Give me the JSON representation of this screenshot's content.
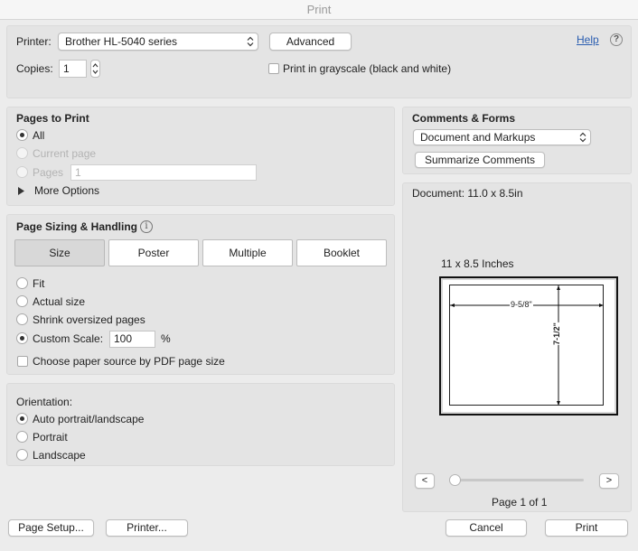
{
  "window": {
    "title": "Print"
  },
  "printer": {
    "label": "Printer:",
    "selected": "Brother HL-5040 series",
    "advanced_label": "Advanced",
    "help_label": "Help",
    "help_icon": "?",
    "copies_label": "Copies:",
    "copies_value": "1",
    "grayscale_label": "Print in grayscale (black and white)",
    "grayscale_checked": false
  },
  "pages_to_print": {
    "title": "Pages to Print",
    "all_label": "All",
    "current_label": "Current page",
    "pages_label": "Pages",
    "pages_placeholder": "1",
    "more_options_label": "More Options",
    "selected": "all"
  },
  "sizing": {
    "title": "Page Sizing & Handling",
    "info_icon": "i",
    "tabs": [
      "Size",
      "Poster",
      "Multiple",
      "Booklet"
    ],
    "active_tab": "Size",
    "fit_label": "Fit",
    "actual_label": "Actual size",
    "shrink_label": "Shrink oversized pages",
    "custom_label": "Custom Scale:",
    "custom_value": "100",
    "percent": "%",
    "paper_source_label": "Choose paper source by PDF page size",
    "selected": "custom"
  },
  "orientation": {
    "title": "Orientation:",
    "auto_label": "Auto portrait/landscape",
    "portrait_label": "Portrait",
    "landscape_label": "Landscape",
    "selected": "auto"
  },
  "comments": {
    "title": "Comments & Forms",
    "selected": "Document and Markups",
    "summarize_label": "Summarize Comments"
  },
  "preview": {
    "document_label": "Document: 11.0 x 8.5in",
    "size_label": "11 x 8.5 Inches",
    "width_dim": "9-5/8\"",
    "height_dim": "7-1/2\"",
    "prev_label": "<",
    "next_label": ">",
    "page_label": "Page 1 of 1",
    "slider_position": 0
  },
  "footer": {
    "page_setup_label": "Page Setup...",
    "printer_label": "Printer...",
    "cancel_label": "Cancel",
    "print_label": "Print"
  }
}
